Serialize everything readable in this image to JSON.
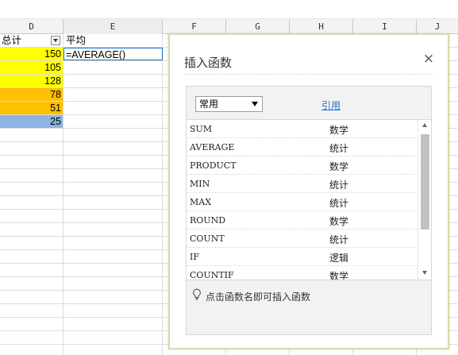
{
  "columns": [
    {
      "letter": "D"
    },
    {
      "letter": "E"
    },
    {
      "letter": "F"
    },
    {
      "letter": "G"
    },
    {
      "letter": "H"
    },
    {
      "letter": "I"
    },
    {
      "letter": "J"
    }
  ],
  "header_row": {
    "total": "总计",
    "average": "平均"
  },
  "formula_cell": "=AVERAGE()",
  "values": [
    {
      "value": "150",
      "color": "#ffff00"
    },
    {
      "value": "105",
      "color": "#ffff00"
    },
    {
      "value": "128",
      "color": "#ffff00"
    },
    {
      "value": "78",
      "color": "#ffc000"
    },
    {
      "value": "51",
      "color": "#ffc000"
    },
    {
      "value": "25",
      "color": "#8db4e2"
    }
  ],
  "dialog": {
    "title": "插入函数",
    "close": "×",
    "category_select": "常用",
    "reference_link": "引用",
    "functions": [
      {
        "name": "SUM",
        "category": "数学"
      },
      {
        "name": "AVERAGE",
        "category": "统计"
      },
      {
        "name": "PRODUCT",
        "category": "数学"
      },
      {
        "name": "MIN",
        "category": "统计"
      },
      {
        "name": "MAX",
        "category": "统计"
      },
      {
        "name": "ROUND",
        "category": "数学"
      },
      {
        "name": "COUNT",
        "category": "统计"
      },
      {
        "name": "IF",
        "category": "逻辑"
      },
      {
        "name": "COUNTIF",
        "category": "数学"
      }
    ],
    "hint": "点击函数名即可插入函数",
    "hint_icon": "lightbulb-icon"
  }
}
